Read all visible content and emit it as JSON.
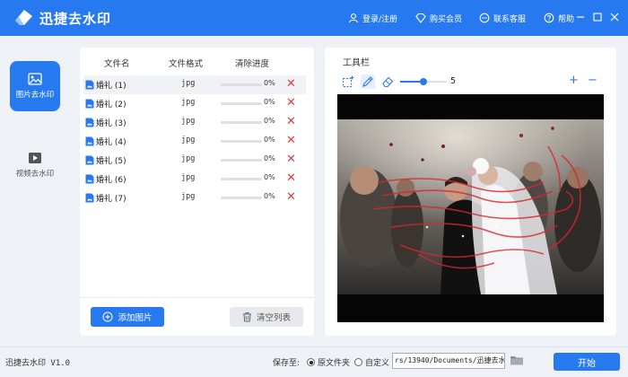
{
  "app": {
    "title": "迅捷去水印"
  },
  "header": {
    "login_label": "登录/注册",
    "vip_label": "购买会员",
    "support_label": "联系客服",
    "help_label": "帮助"
  },
  "sidebar": {
    "items": [
      {
        "label": "图片去水印",
        "icon": "image-icon",
        "active": true
      },
      {
        "label": "视频去水印",
        "icon": "video-icon",
        "active": false
      }
    ]
  },
  "file_list": {
    "columns": [
      "文件名",
      "文件格式",
      "清除进度"
    ],
    "rows": [
      {
        "name": "婚礼 (1)",
        "format": "jpg",
        "progress": "0%",
        "progress_value": 0
      },
      {
        "name": "婚礼 (2)",
        "format": "jpg",
        "progress": "0%",
        "progress_value": 0
      },
      {
        "name": "婚礼 (3)",
        "format": "jpg",
        "progress": "0%",
        "progress_value": 0
      },
      {
        "name": "婚礼 (4)",
        "format": "jpg",
        "progress": "0%",
        "progress_value": 0
      },
      {
        "name": "婚礼 (5)",
        "format": "jpg",
        "progress": "0%",
        "progress_value": 0
      },
      {
        "name": "婚礼 (6)",
        "format": "jpg",
        "progress": "0%",
        "progress_value": 0
      },
      {
        "name": "婚礼 (7)",
        "format": "jpg",
        "progress": "0%",
        "progress_value": 0
      }
    ],
    "add_label": "添加图片",
    "clear_label": "清空列表"
  },
  "tools": {
    "title": "工具栏",
    "brush_size": "5",
    "brush_slider_fraction": 0.5,
    "zoom_in": "+",
    "zoom_out": "−",
    "icons": [
      "rect-select-icon",
      "brush-icon",
      "eraser-icon"
    ]
  },
  "bottom": {
    "version": "迅捷去水印 V1.0",
    "save_to_label": "保存至:",
    "option_original": "原文件夹",
    "option_custom": "自定义",
    "selected_option": "原文件夹",
    "path_value": "rs/13940/Documents/迅捷去水印",
    "start_label": "开始"
  },
  "colors": {
    "accent": "#2779f0",
    "delete": "#e23b3b",
    "brush_stroke": "#d9262c"
  }
}
